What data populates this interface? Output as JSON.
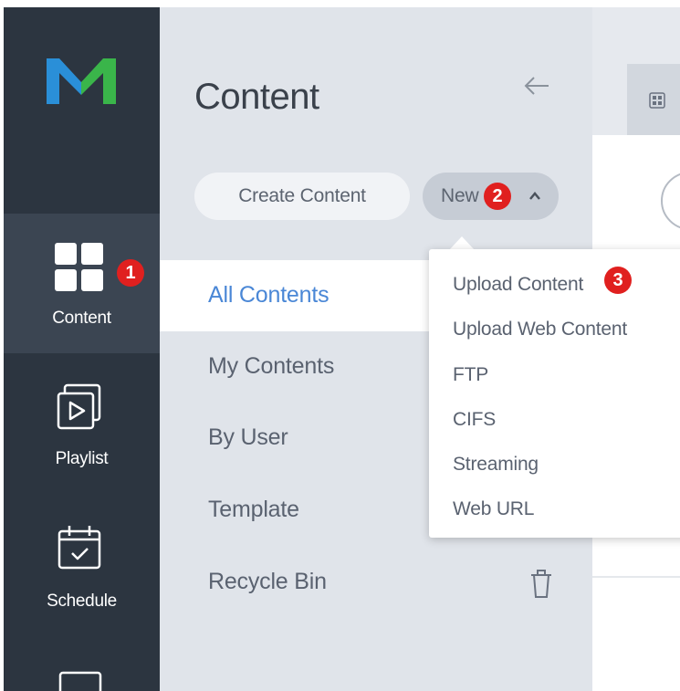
{
  "nav": {
    "items": [
      {
        "label": "Content",
        "icon": "grid-icon",
        "active": true
      },
      {
        "label": "Playlist",
        "icon": "playlist-icon",
        "active": false
      },
      {
        "label": "Schedule",
        "icon": "calendar-icon",
        "active": false
      }
    ]
  },
  "panel": {
    "title": "Content",
    "create_button": "Create Content",
    "new_button": "New",
    "menu": [
      "All Contents",
      "My Contents",
      "By User",
      "Template",
      "Recycle Bin"
    ]
  },
  "dropdown": {
    "items": [
      "Upload Content",
      "Upload Web Content",
      "FTP",
      "CIFS",
      "Streaming",
      "Web URL"
    ]
  },
  "callouts": [
    "1",
    "2",
    "3"
  ],
  "colors": {
    "rail": "#2c3540",
    "rail_active": "#3b4552",
    "panel": "#e0e4ea",
    "accent": "#4a87d6",
    "badge": "#e0201f",
    "logo_blue": "#2a8fd8",
    "logo_green": "#3ab54a"
  }
}
